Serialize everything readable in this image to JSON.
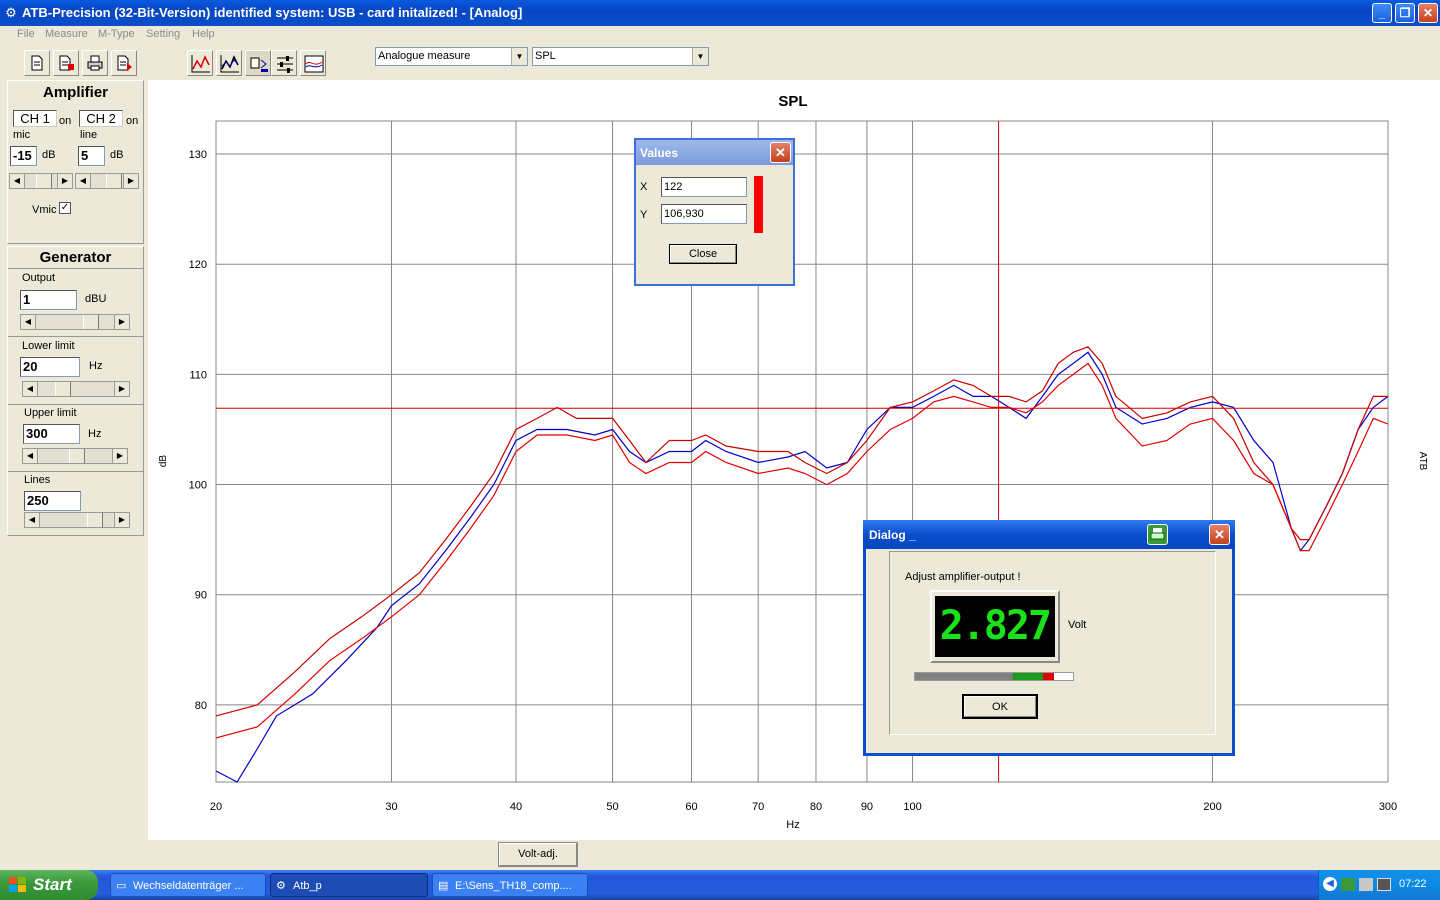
{
  "window": {
    "title": "ATB-Precision  (32-Bit-Version)  identified system: USB - card  initalized! - [Analog]",
    "minimize": "_",
    "restore": "❐",
    "close": "✕"
  },
  "menu": [
    "File",
    "Measure",
    "M-Type",
    "Setting",
    "Help"
  ],
  "toolbar": {
    "measure_mode": "Analogue measure",
    "display_type": "SPL"
  },
  "amplifier": {
    "title": "Amplifier",
    "ch1_label": "CH 1",
    "ch1_state": "on",
    "ch1_sub": "mic",
    "ch1_value": "-15",
    "ch1_unit": "dB",
    "ch2_label": "CH 2",
    "ch2_state": "on",
    "ch2_sub": "line",
    "ch2_value": "5",
    "ch2_unit": "dB",
    "vmic_label": "Vmic",
    "vmic_checked": "✓"
  },
  "generator": {
    "title": "Generator",
    "output_label": "Output",
    "output_value": "1",
    "output_unit": "dBU",
    "lower_label": "Lower limit",
    "lower_value": "20",
    "lower_unit": "Hz",
    "upper_label": "Upper limit",
    "upper_value": "300",
    "upper_unit": "Hz",
    "lines_label": "Lines",
    "lines_value": "250"
  },
  "chart_data": {
    "type": "line",
    "title": "SPL",
    "xlabel": "Hz",
    "ylabel": "dB",
    "right_label": "ATB",
    "x_scale": "log",
    "xlim": [
      20,
      300
    ],
    "ylim": [
      73,
      133
    ],
    "x_ticks": [
      20,
      30,
      40,
      50,
      60,
      70,
      80,
      90,
      100,
      200,
      300
    ],
    "y_ticks": [
      80,
      90,
      100,
      110,
      120,
      130
    ],
    "grid": true,
    "cursor": {
      "x": 122,
      "y": 106.93
    },
    "series": [
      {
        "color": "#0000C8",
        "points": [
          [
            20,
            74
          ],
          [
            21,
            73
          ],
          [
            22,
            76
          ],
          [
            23,
            79
          ],
          [
            25,
            81
          ],
          [
            27,
            84
          ],
          [
            29,
            87
          ],
          [
            30,
            89
          ],
          [
            32,
            91
          ],
          [
            34,
            94
          ],
          [
            36,
            97
          ],
          [
            38,
            100
          ],
          [
            40,
            104
          ],
          [
            42,
            105
          ],
          [
            45,
            105
          ],
          [
            48,
            104.5
          ],
          [
            50,
            105
          ],
          [
            52,
            103
          ],
          [
            54,
            102
          ],
          [
            57,
            103
          ],
          [
            60,
            103
          ],
          [
            62,
            104
          ],
          [
            65,
            103
          ],
          [
            70,
            102
          ],
          [
            75,
            102.5
          ],
          [
            78,
            103
          ],
          [
            82,
            101.5
          ],
          [
            86,
            102
          ],
          [
            90,
            105
          ],
          [
            95,
            107
          ],
          [
            100,
            107
          ],
          [
            105,
            108
          ],
          [
            110,
            109
          ],
          [
            115,
            108
          ],
          [
            120,
            108
          ],
          [
            125,
            107
          ],
          [
            130,
            106
          ],
          [
            135,
            108
          ],
          [
            140,
            110
          ],
          [
            145,
            111
          ],
          [
            150,
            112
          ],
          [
            155,
            110
          ],
          [
            160,
            107
          ],
          [
            170,
            105.5
          ],
          [
            180,
            106
          ],
          [
            190,
            107
          ],
          [
            200,
            107.5
          ],
          [
            210,
            107
          ],
          [
            220,
            104
          ],
          [
            230,
            102
          ],
          [
            240,
            96
          ],
          [
            245,
            94
          ],
          [
            250,
            95
          ],
          [
            260,
            98
          ],
          [
            270,
            101
          ],
          [
            280,
            105
          ],
          [
            290,
            107
          ],
          [
            300,
            108
          ]
        ]
      },
      {
        "color": "#C80000",
        "points": [
          [
            20,
            79
          ],
          [
            22,
            80
          ],
          [
            24,
            83
          ],
          [
            26,
            86
          ],
          [
            28,
            88
          ],
          [
            30,
            90
          ],
          [
            32,
            92
          ],
          [
            34,
            95
          ],
          [
            36,
            98
          ],
          [
            38,
            101
          ],
          [
            40,
            105
          ],
          [
            42,
            106
          ],
          [
            44,
            107
          ],
          [
            46,
            106
          ],
          [
            50,
            106
          ],
          [
            52,
            104
          ],
          [
            54,
            102
          ],
          [
            57,
            104
          ],
          [
            60,
            104
          ],
          [
            62,
            104.5
          ],
          [
            65,
            103.5
          ],
          [
            70,
            103
          ],
          [
            75,
            103
          ],
          [
            78,
            102
          ],
          [
            82,
            101
          ],
          [
            86,
            102
          ],
          [
            90,
            104
          ],
          [
            95,
            107
          ],
          [
            100,
            107.5
          ],
          [
            105,
            108.5
          ],
          [
            110,
            109.5
          ],
          [
            115,
            109
          ],
          [
            120,
            108
          ],
          [
            125,
            108
          ],
          [
            130,
            107.5
          ],
          [
            135,
            108.5
          ],
          [
            140,
            111
          ],
          [
            145,
            112
          ],
          [
            150,
            112.5
          ],
          [
            155,
            111
          ],
          [
            160,
            108
          ],
          [
            170,
            106
          ],
          [
            180,
            106.5
          ],
          [
            190,
            107.5
          ],
          [
            200,
            108
          ],
          [
            210,
            106
          ],
          [
            220,
            102
          ],
          [
            230,
            100
          ],
          [
            240,
            96
          ],
          [
            245,
            95
          ],
          [
            250,
            95
          ],
          [
            260,
            98
          ],
          [
            270,
            101
          ],
          [
            280,
            105
          ],
          [
            290,
            108
          ],
          [
            300,
            108
          ]
        ]
      },
      {
        "color": "#E00000",
        "points": [
          [
            20,
            77
          ],
          [
            22,
            78
          ],
          [
            24,
            81
          ],
          [
            26,
            84
          ],
          [
            28,
            86
          ],
          [
            30,
            88
          ],
          [
            32,
            90
          ],
          [
            34,
            93
          ],
          [
            36,
            96
          ],
          [
            38,
            99
          ],
          [
            40,
            103
          ],
          [
            42,
            104.5
          ],
          [
            45,
            104.5
          ],
          [
            48,
            104
          ],
          [
            50,
            104.5
          ],
          [
            52,
            102
          ],
          [
            54,
            101
          ],
          [
            57,
            102
          ],
          [
            60,
            102
          ],
          [
            62,
            103
          ],
          [
            65,
            102
          ],
          [
            70,
            101
          ],
          [
            75,
            101.5
          ],
          [
            78,
            101
          ],
          [
            82,
            100
          ],
          [
            86,
            101
          ],
          [
            90,
            103
          ],
          [
            95,
            105
          ],
          [
            100,
            106
          ],
          [
            105,
            107.5
          ],
          [
            110,
            108
          ],
          [
            115,
            107.5
          ],
          [
            120,
            107
          ],
          [
            125,
            107
          ],
          [
            130,
            106.5
          ],
          [
            135,
            107.5
          ],
          [
            140,
            109
          ],
          [
            145,
            110
          ],
          [
            150,
            111
          ],
          [
            155,
            109
          ],
          [
            160,
            106
          ],
          [
            170,
            103.5
          ],
          [
            180,
            104
          ],
          [
            190,
            105.5
          ],
          [
            200,
            106
          ],
          [
            210,
            104
          ],
          [
            220,
            101
          ],
          [
            230,
            100
          ],
          [
            240,
            96
          ],
          [
            245,
            94
          ],
          [
            250,
            94
          ],
          [
            260,
            97
          ],
          [
            270,
            100
          ],
          [
            280,
            103
          ],
          [
            290,
            106
          ],
          [
            300,
            105.5
          ]
        ]
      }
    ]
  },
  "values_dialog": {
    "title": "Values",
    "x_label": "X",
    "x_value": "122",
    "y_label": "Y",
    "y_value": "106,930",
    "close_label": "Close",
    "x_close": "✕"
  },
  "adjust_dialog": {
    "title": "Dialog _",
    "message": "Adjust amplifier-output !",
    "reading": "2.827",
    "unit": "Volt",
    "level_fraction": 0.88,
    "ok_label": "OK",
    "x_close": "✕"
  },
  "volt_adj_label": "Volt-adj.",
  "taskbar": {
    "start_label": "Start",
    "tasks": [
      "Wechseldatenträger ...",
      "Atb_p",
      "E:\\Sens_TH18_comp...."
    ],
    "clock": "07:22"
  }
}
